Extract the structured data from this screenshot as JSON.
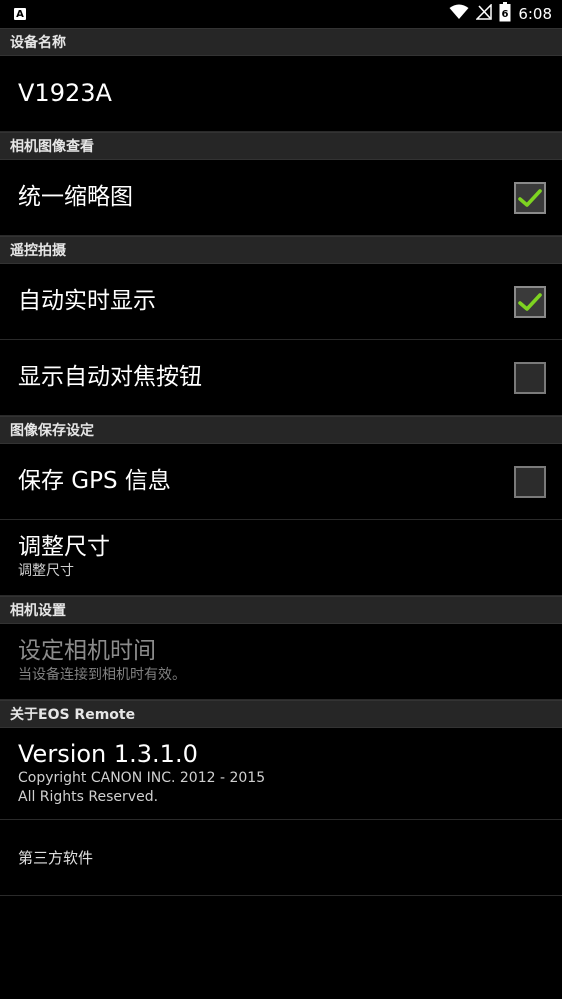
{
  "status_bar": {
    "notification_icon": "A",
    "icons": [
      "wifi-icon",
      "signal-icon",
      "battery-icon"
    ],
    "battery_level": 6,
    "time": "6:08"
  },
  "sections": {
    "device_name": {
      "header": "设备名称",
      "value": "V1923A"
    },
    "camera_view": {
      "header": "相机图像查看",
      "unified_thumbnail": {
        "label": "统一缩略图",
        "checked": true
      }
    },
    "remote_shooting": {
      "header": "遥控拍摄",
      "auto_live_view": {
        "label": "自动实时显示",
        "checked": true
      },
      "show_af_button": {
        "label": "显示自动对焦按钮",
        "checked": false
      }
    },
    "image_save": {
      "header": "图像保存设定",
      "save_gps": {
        "label": "保存 GPS 信息",
        "checked": false
      },
      "resize": {
        "label": "调整尺寸",
        "summary": "调整尺寸"
      }
    },
    "camera_settings": {
      "header": "相机设置",
      "set_time": {
        "label": "设定相机时间",
        "summary": "当设备连接到相机时有效。"
      }
    },
    "about": {
      "header": "关于EOS Remote",
      "version": "Version 1.3.1.0",
      "copyright": "Copyright CANON INC. 2012 - 2015",
      "rights": "All Rights Reserved.",
      "third_party": "第三方软件"
    }
  },
  "colors": {
    "check_green": "#7ed321",
    "section_bg": "#262626",
    "background": "#000000"
  }
}
